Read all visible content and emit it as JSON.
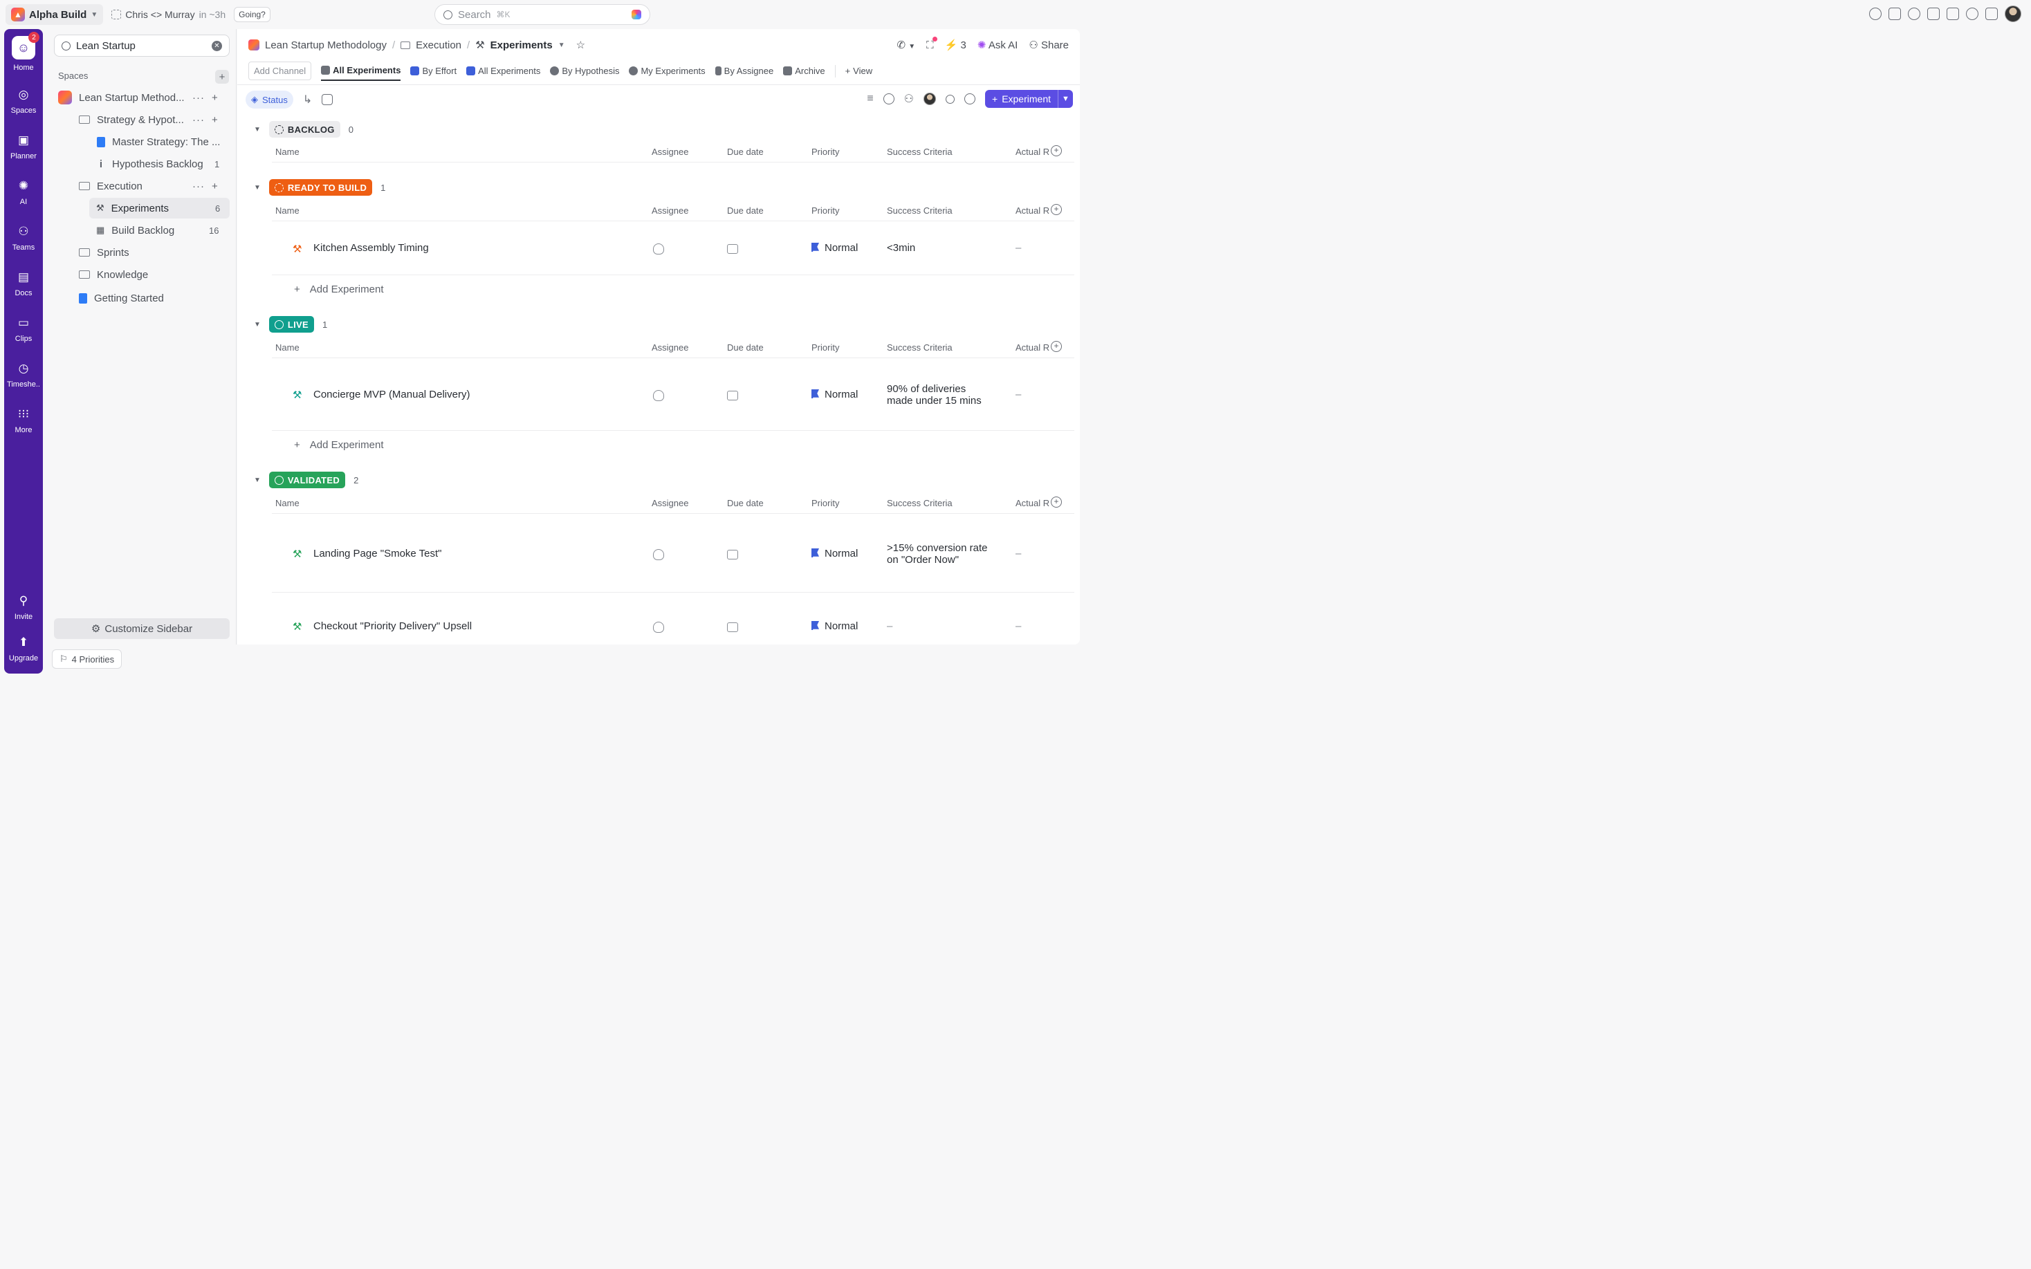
{
  "topbar": {
    "workspace": "Alpha Build",
    "meeting_title": "Chris <> Murray",
    "meeting_time": "in ~3h",
    "going_label": "Going?",
    "search_placeholder": "Search",
    "search_shortcut": "⌘K"
  },
  "rail": {
    "home": "Home",
    "home_badge": "2",
    "spaces": "Spaces",
    "planner": "Planner",
    "ai": "AI",
    "teams": "Teams",
    "docs": "Docs",
    "clips": "Clips",
    "timesheets": "Timeshe..",
    "more": "More",
    "invite": "Invite",
    "upgrade": "Upgrade"
  },
  "sidebar": {
    "search_value": "Lean Startup",
    "spaces_heading": "Spaces",
    "space_name": "Lean Startup Method...",
    "folder_strategy": "Strategy & Hypot...",
    "doc_master": "Master Strategy: The ...",
    "list_hypothesis": "Hypothesis Backlog",
    "list_hypothesis_count": "1",
    "folder_execution": "Execution",
    "list_experiments": "Experiments",
    "list_experiments_count": "6",
    "list_build": "Build Backlog",
    "list_build_count": "16",
    "folder_sprints": "Sprints",
    "folder_knowledge": "Knowledge",
    "doc_getting_started": "Getting Started",
    "customize": "Customize Sidebar",
    "priorities": "4 Priorities"
  },
  "header": {
    "crumb_space": "Lean Startup Methodology",
    "crumb_folder": "Execution",
    "crumb_list": "Experiments",
    "notif_count": "3",
    "ask_ai": "Ask AI",
    "share": "Share"
  },
  "views": {
    "add_channel": "Add Channel",
    "tabs": [
      "All Experiments",
      "By Effort",
      "All Experiments",
      "By Hypothesis",
      "My Experiments",
      "By Assignee",
      "Archive"
    ],
    "add_view": "View"
  },
  "toolbar": {
    "group_by": "Status",
    "new_button": "Experiment"
  },
  "columns": {
    "name": "Name",
    "assignee": "Assignee",
    "due_date": "Due date",
    "priority": "Priority",
    "success": "Success Criteria",
    "actual": "Actual R"
  },
  "add_experiment": "Add Experiment",
  "groups": {
    "backlog": {
      "label": "BACKLOG",
      "count": "0"
    },
    "ready": {
      "label": "READY TO BUILD",
      "count": "1"
    },
    "live": {
      "label": "LIVE",
      "count": "1"
    },
    "validated": {
      "label": "VALIDATED",
      "count": "2"
    }
  },
  "tasks": {
    "t1": {
      "name": "Kitchen Assembly Timing",
      "priority": "Normal",
      "success_1": "<3min",
      "success_2": "",
      "actual": "–"
    },
    "t2": {
      "name": "Concierge MVP (Manual Delivery)",
      "priority": "Normal",
      "success_1": "90% of deliveries",
      "success_2": "made under 15 mins",
      "actual": "–"
    },
    "t3": {
      "name": "Landing Page \"Smoke Test\"",
      "priority": "Normal",
      "success_1": ">15% conversion rate",
      "success_2": "on \"Order Now\"",
      "actual": "–"
    },
    "t4": {
      "name": "Checkout \"Priority Delivery\" Upsell",
      "priority": "Normal",
      "success_1": "–",
      "success_2": "",
      "actual": "–"
    }
  },
  "colors": {
    "rail": "#4a1f9e",
    "ready": "#ee5e13",
    "live": "#109f8e",
    "validated": "#27a35a",
    "primary": "#5b4de3",
    "flag": "#3d5fd9"
  }
}
